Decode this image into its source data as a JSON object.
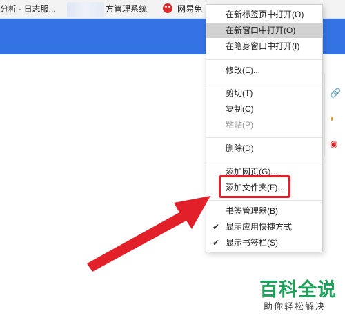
{
  "bookmarks_bar": {
    "items": [
      {
        "label": "分析 - 日志服..."
      },
      {
        "label": "方管理系统"
      },
      {
        "label": "网易免"
      }
    ]
  },
  "context_menu": {
    "items": [
      {
        "label": "在新标签页中打开(O)"
      },
      {
        "label": "在新窗口中打开(O)"
      },
      {
        "label": "在隐身窗口中打开(I)"
      },
      {
        "label": "修改(E)..."
      },
      {
        "label": "剪切(T)"
      },
      {
        "label": "复制(C)"
      },
      {
        "label": "粘贴(P)"
      },
      {
        "label": "删除(D)"
      },
      {
        "label": "添加网页(G)..."
      },
      {
        "label": "添加文件夹(F)..."
      },
      {
        "label": "书签管理器(B)"
      },
      {
        "label": "显示应用快捷方式"
      },
      {
        "label": "显示书签栏(S)"
      }
    ]
  },
  "watermark": {
    "title": "百科全说",
    "subtitle": "助你轻松解决"
  },
  "colors": {
    "header_blue": "#3473e4",
    "highlight_red": "#e2202a",
    "watermark_green": "#1da15a"
  }
}
